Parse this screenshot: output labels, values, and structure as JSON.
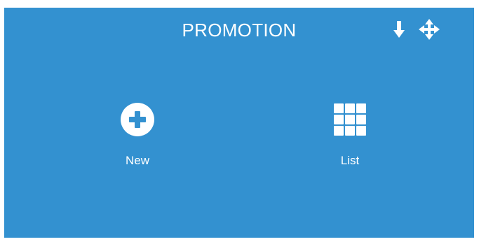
{
  "header": {
    "title": "PROMOTION",
    "icons": [
      "arrow-down-icon",
      "move-icon"
    ]
  },
  "actions": [
    {
      "label": "New",
      "icon": "plus-circle-icon"
    },
    {
      "label": "List",
      "icon": "grid-icon"
    }
  ],
  "colors": {
    "panel_background": "#3391d0",
    "foreground": "#ffffff"
  }
}
